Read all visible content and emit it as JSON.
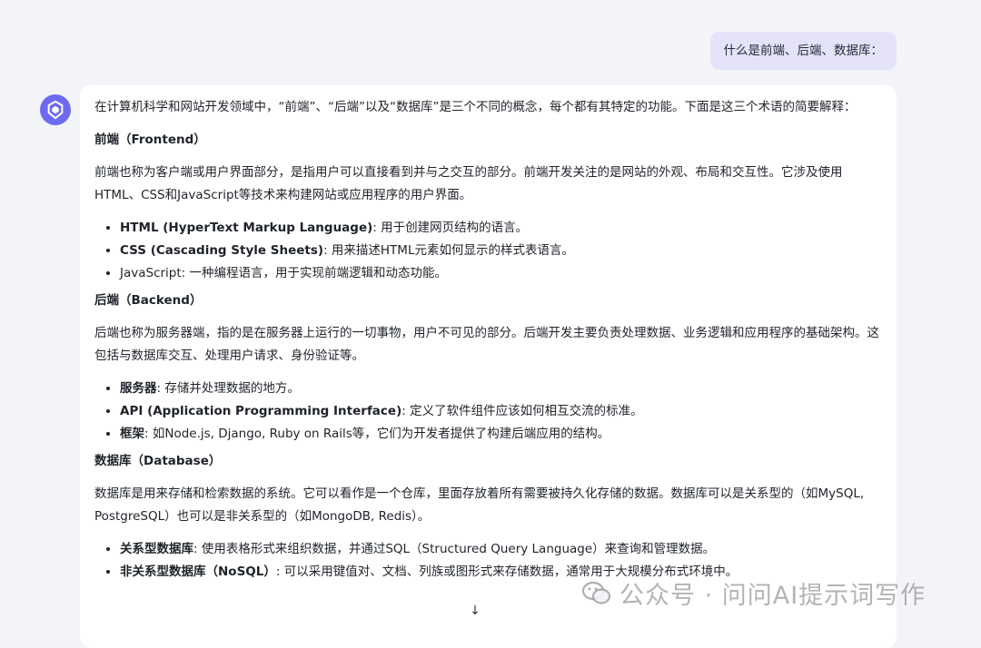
{
  "user_message": "什么是前端、后端、数据库：",
  "answer": {
    "intro": "在计算机科学和网站开发领域中，“前端”、“后端”以及“数据库”是三个不同的概念，每个都有其特定的功能。下面是这三个术语的简要解释：",
    "frontend": {
      "heading": "前端（Frontend）",
      "body": "前端也称为客户端或用户界面部分，是指用户可以直接看到并与之交互的部分。前端开发关注的是网站的外观、布局和交互性。它涉及使用HTML、CSS和JavaScript等技术来构建网站或应用程序的用户界面。",
      "items": [
        {
          "term": "HTML (HyperText Markup Language)",
          "desc": ": 用于创建网页结构的语言。"
        },
        {
          "term": "CSS (Cascading Style Sheets)",
          "desc": ": 用来描述HTML元素如何显示的样式表语言。"
        },
        {
          "term": "JavaScript",
          "desc": ": 一种编程语言，用于实现前端逻辑和动态功能。"
        }
      ]
    },
    "backend": {
      "heading": "后端（Backend）",
      "body": "后端也称为服务器端，指的是在服务器上运行的一切事物，用户不可见的部分。后端开发主要负责处理数据、业务逻辑和应用程序的基础架构。这包括与数据库交互、处理用户请求、身份验证等。",
      "items": [
        {
          "term": "服务器",
          "desc": ": 存储并处理数据的地方。"
        },
        {
          "term": "API (Application Programming Interface)",
          "desc": ": 定义了软件组件应该如何相互交流的标准。"
        },
        {
          "term": "框架",
          "desc": ": 如Node.js, Django, Ruby on Rails等，它们为开发者提供了构建后端应用的结构。"
        }
      ]
    },
    "database": {
      "heading": "数据库（Database）",
      "body": "数据库是用来存储和检索数据的系统。它可以看作是一个仓库，里面存放着所有需要被持久化存储的数据。数据库可以是关系型的（如MySQL, PostgreSQL）也可以是非关系型的（如MongoDB, Redis）。",
      "items": [
        {
          "term": "关系型数据库",
          "desc": ": 使用表格形式来组织数据，并通过SQL（Structured Query Language）来查询和管理数据。"
        },
        {
          "term": "非关系型数据库（NoSQL）",
          "desc": ": 可以采用键值对、文档、列族或图形式来存储数据，通常用于大规模分布式环境中。"
        }
      ]
    }
  },
  "watermark": "公众号 · 问问AI提示词写作",
  "icons": {
    "assistant_avatar": "ai-logo-icon",
    "scroll": "arrow-down-icon",
    "watermark": "wechat-icon"
  },
  "colors": {
    "user_bubble": "#e4e3fa",
    "avatar": "#6e6af0",
    "page_bg": "#f3f4f8"
  }
}
